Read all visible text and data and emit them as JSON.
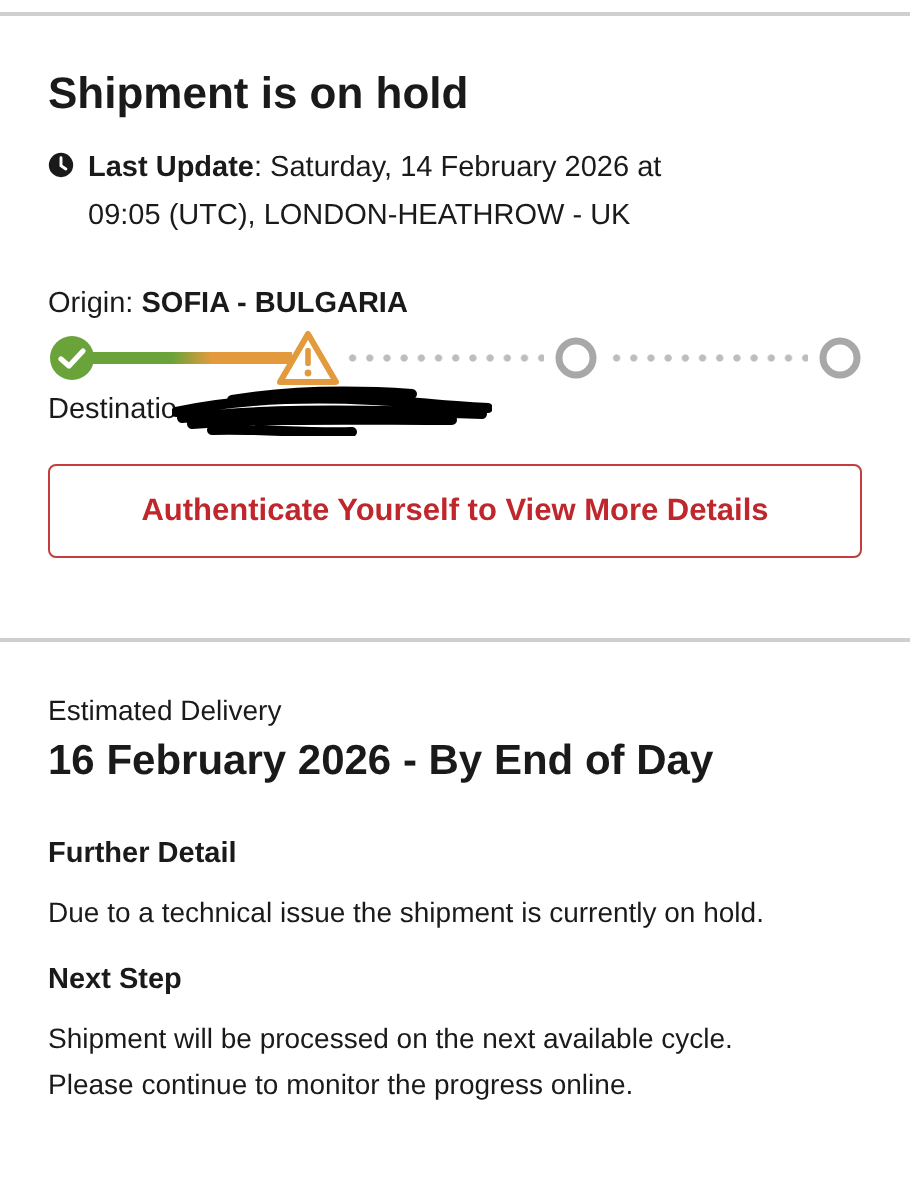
{
  "status": {
    "title": "Shipment is on hold",
    "last_update_label": "Last Update",
    "last_update_text": ": Saturday, 14 February 2026 at 09:05 (UTC), LONDON-HEATHROW - UK",
    "origin_label": "Origin: ",
    "origin_value": "SOFIA - BULGARIA",
    "steps": [
      {
        "kind": "done"
      },
      {
        "kind": "hold"
      },
      {
        "kind": "pending"
      },
      {
        "kind": "pending"
      }
    ],
    "destination_label": "Destinatio",
    "destination_redacted": true,
    "button": "Authenticate Yourself to View More Details"
  },
  "delivery": {
    "label": "Estimated Delivery",
    "date": "16 February 2026 - By End of Day"
  },
  "sections": [
    {
      "heading": "Further Detail",
      "text": "Due to a technical issue the shipment is currently on hold."
    },
    {
      "heading": "Next Step",
      "text": "Shipment will be processed on the next available cycle.\nPlease continue to monitor the progress online."
    }
  ]
}
